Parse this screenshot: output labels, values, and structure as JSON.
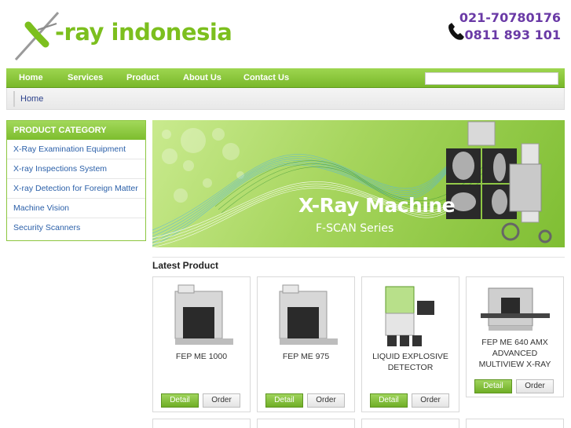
{
  "header": {
    "logo_text": "-ray indonesia",
    "phone_1": "021-70780176",
    "phone_2": "0811 893 101"
  },
  "nav": {
    "items": [
      "Home",
      "Services",
      "Product",
      "About Us",
      "Contact Us"
    ],
    "search_placeholder": ""
  },
  "breadcrumb": {
    "home": "Home"
  },
  "sidebar": {
    "title": "PRODUCT CATEGORY",
    "items": [
      "X-Ray Examination Equipment",
      "X-ray Inspections System",
      "X-ray Detection for Foreign Matter",
      "Machine Vision",
      "Security Scanners"
    ]
  },
  "banner": {
    "title": "X-Ray Machine",
    "subtitle": "F-SCAN Series"
  },
  "latest": {
    "title": "Latest Product",
    "products": [
      {
        "name": "FEP ME 1000",
        "detail": "Detail",
        "order": "Order"
      },
      {
        "name": "FEP ME 975",
        "detail": "Detail",
        "order": "Order"
      },
      {
        "name": "LIQUID EXPLOSIVE DETECTOR",
        "detail": "Detail",
        "order": "Order"
      },
      {
        "name": "FEP ME 640 AMX ADVANCED MULTIVIEW X-RAY",
        "detail": "Detail",
        "order": "Order"
      }
    ]
  },
  "colors": {
    "brand_green": "#7cbf1e",
    "phone_purple": "#6a3aa6",
    "link_blue": "#2a5fa8"
  }
}
